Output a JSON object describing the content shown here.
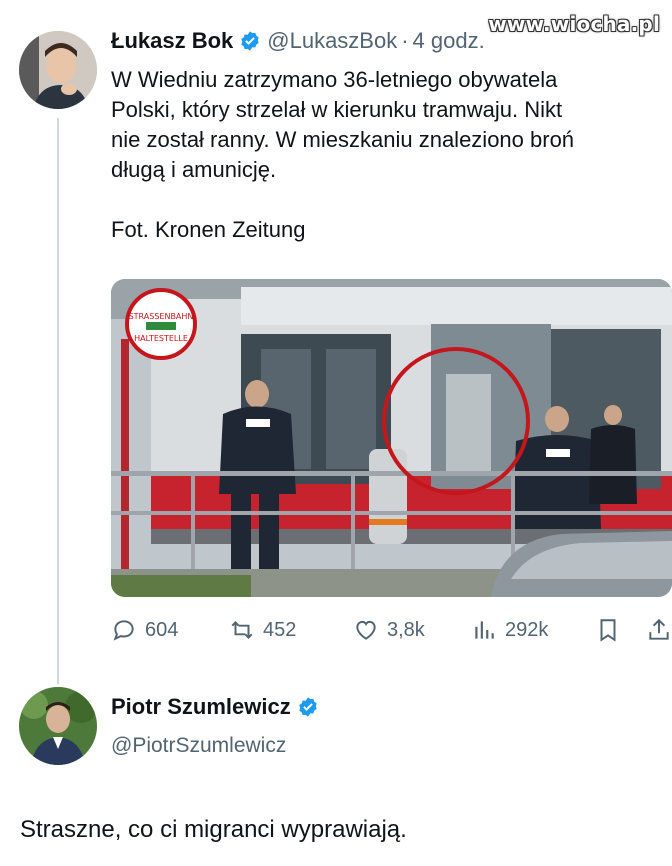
{
  "watermark": "www.wiocha.pl",
  "tweet": {
    "author_name": "Łukasz Bok",
    "author_handle": "@LukaszBok",
    "separator": "·",
    "time": "4 godz.",
    "text_lines": [
      "W Wiedniu zatrzymano 36-letniego obywatela",
      "Polski, który strzelał w kierunku tramwaju. Nikt",
      "nie został ranny. W mieszkaniu znaleziono broń",
      "długą i amunicję."
    ],
    "photo_credit": "Fot. Kronen Zeitung",
    "image_sign_text": "STRASSENBAHN HALTESTELLE",
    "police_label": "POLIZEI",
    "stats": {
      "replies": "604",
      "reposts": "452",
      "likes": "3,8k",
      "views": "292k"
    }
  },
  "reply": {
    "author_name": "Piotr Szumlewicz",
    "author_handle": "@PiotrSzumlewicz",
    "text": "Straszne, co ci migranci wyprawiają."
  },
  "colors": {
    "verified": "#1d9bf0",
    "muted": "#536471",
    "text": "#0f1419",
    "thread_line": "#cfd9de",
    "highlight_circle": "#c4161c"
  }
}
